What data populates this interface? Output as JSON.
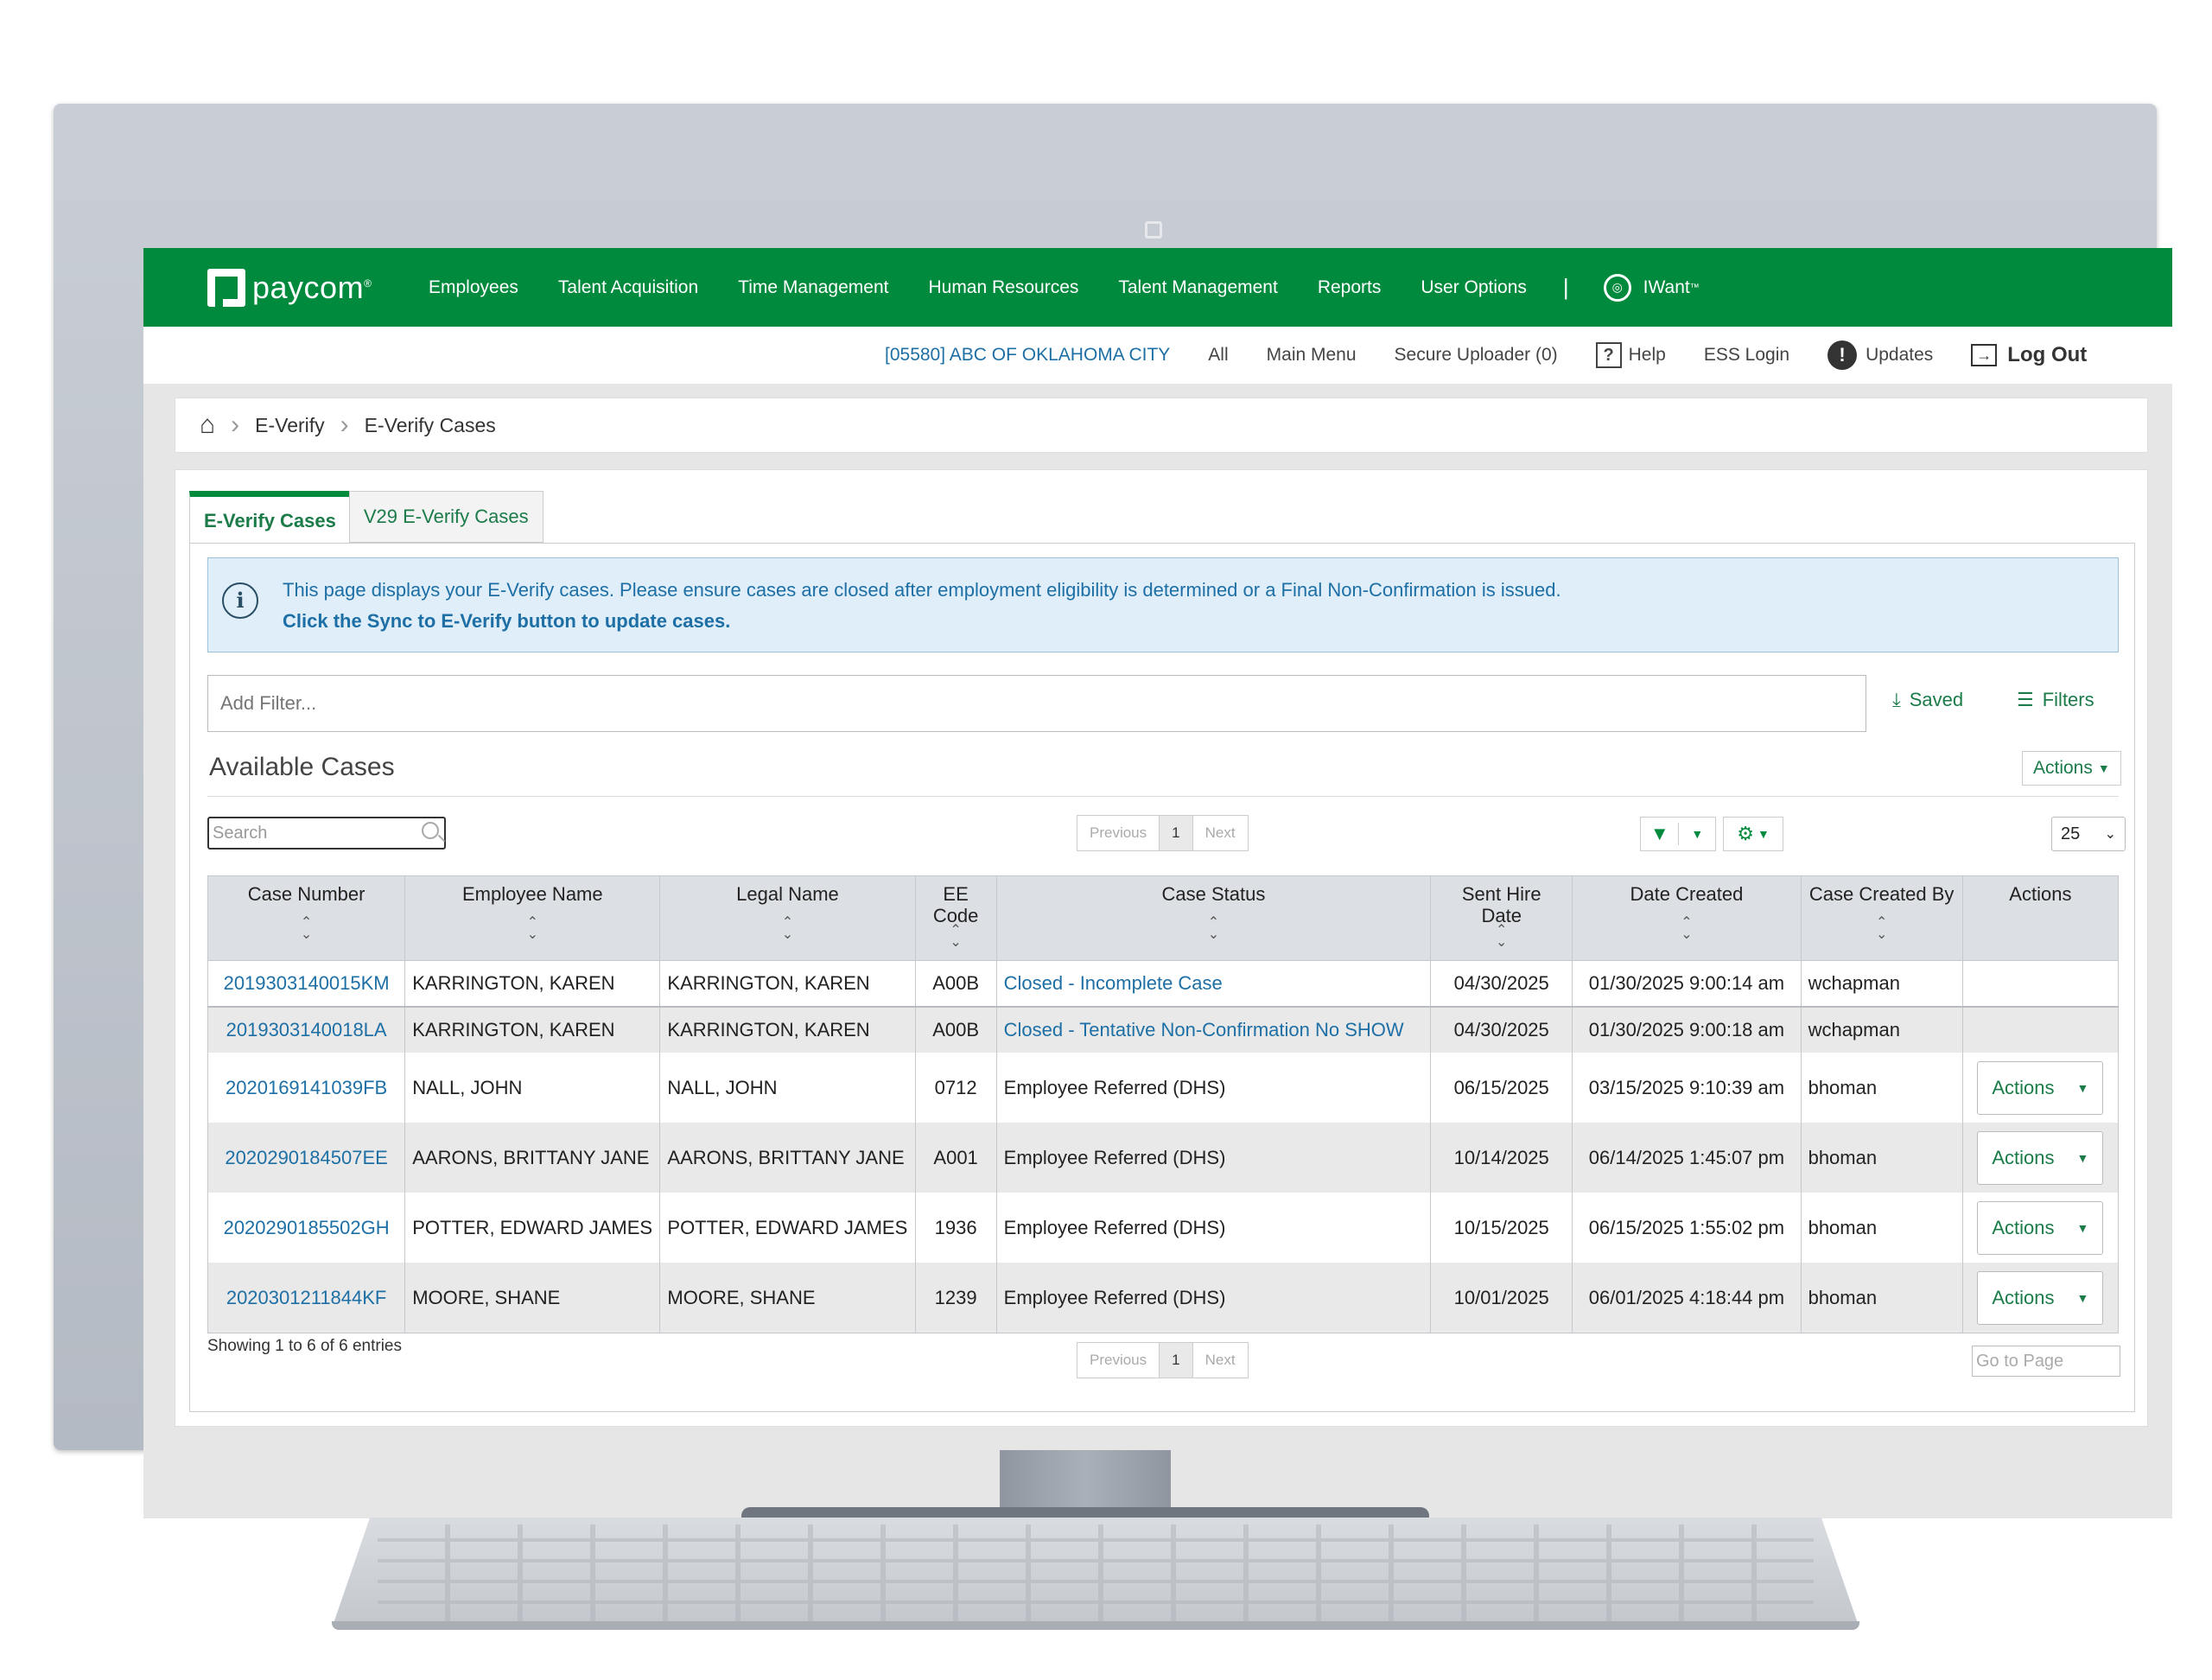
{
  "brand": {
    "logo_text": "paycom",
    "logo_mark": "®"
  },
  "topnav": {
    "items": [
      "Employees",
      "Talent Acquisition",
      "Time Management",
      "Human Resources",
      "Talent Management",
      "Reports",
      "User Options"
    ],
    "separator": "|",
    "iwant_label": "IWant",
    "iwant_tm": "™"
  },
  "subnav": {
    "company": "[05580] ABC OF OKLAHOMA CITY",
    "all": "All",
    "main_menu": "Main Menu",
    "secure_uploader": "Secure Uploader (0)",
    "help": "Help",
    "ess_login": "ESS Login",
    "updates": "Updates",
    "log_out": "Log Out"
  },
  "breadcrumb": {
    "items": [
      "E-Verify",
      "E-Verify Cases"
    ]
  },
  "tabs": {
    "active": "E-Verify Cases",
    "inactive": "V29 E-Verify Cases"
  },
  "info": {
    "line1": "This page displays your E-Verify cases. Please ensure cases are closed after employment eligibility is determined or a Final Non-Confirmation is issued.",
    "line2": "Click the Sync to E-Verify button to update cases."
  },
  "filter": {
    "placeholder": "Add Filter...",
    "saved_label": "Saved",
    "filters_label": "Filters"
  },
  "section": {
    "title": "Available Cases",
    "actions_label": "Actions"
  },
  "search": {
    "placeholder": "Search"
  },
  "pager": {
    "previous": "Previous",
    "current": "1",
    "next": "Next"
  },
  "page_size": "25",
  "table": {
    "headers": [
      "Case Number",
      "Employee Name",
      "Legal Name",
      "EE Code",
      "Case Status",
      "Sent Hire Date",
      "Date Created",
      "Case Created By",
      "Actions"
    ],
    "rows": [
      {
        "case": "2019303140015KM",
        "employee": "KARRINGTON, KAREN",
        "legal": "KARRINGTON, KAREN",
        "ee": "A00B",
        "status": "Closed - Incomplete Case",
        "hire": "04/30/2025",
        "created": "01/30/2025 9:00:14 am",
        "by": "wchapman",
        "action": ""
      },
      {
        "case": "2019303140018LA",
        "employee": "KARRINGTON, KAREN",
        "legal": "KARRINGTON, KAREN",
        "ee": "A00B",
        "status": "Closed - Tentative Non-Confirmation No SHOW",
        "hire": "04/30/2025",
        "created": "01/30/2025 9:00:18 am",
        "by": "wchapman",
        "action": ""
      },
      {
        "case": "2020169141039FB",
        "employee": "NALL, JOHN",
        "legal": "NALL, JOHN",
        "ee": "0712",
        "status": "Employee Referred (DHS)",
        "hire": "06/15/2025",
        "created": "03/15/2025 9:10:39 am",
        "by": "bhoman",
        "action": "Actions"
      },
      {
        "case": "2020290184507EE",
        "employee": "AARONS, BRITTANY JANE",
        "legal": "AARONS, BRITTANY JANE",
        "ee": "A001",
        "status": "Employee Referred (DHS)",
        "hire": "10/14/2025",
        "created": "06/14/2025 1:45:07 pm",
        "by": "bhoman",
        "action": "Actions"
      },
      {
        "case": "2020290185502GH",
        "employee": "POTTER, EDWARD JAMES",
        "legal": "POTTER, EDWARD JAMES",
        "ee": "1936",
        "status": "Employee Referred (DHS)",
        "hire": "10/15/2025",
        "created": "06/15/2025 1:55:02 pm",
        "by": "bhoman",
        "action": "Actions"
      },
      {
        "case": "2020301211844KF",
        "employee": "MOORE, SHANE",
        "legal": "MOORE, SHANE",
        "ee": "1239",
        "status": "Employee Referred (DHS)",
        "hire": "10/01/2025",
        "created": "06/01/2025 4:18:44 pm",
        "by": "bhoman",
        "action": "Actions"
      }
    ]
  },
  "footer": {
    "showing": "Showing 1 to 6 of 6 entries",
    "goto_placeholder": "Go to Page"
  },
  "colors": {
    "brand_green": "#008a3e",
    "link_blue": "#1d6fa5",
    "info_bg": "#dfeef8"
  }
}
